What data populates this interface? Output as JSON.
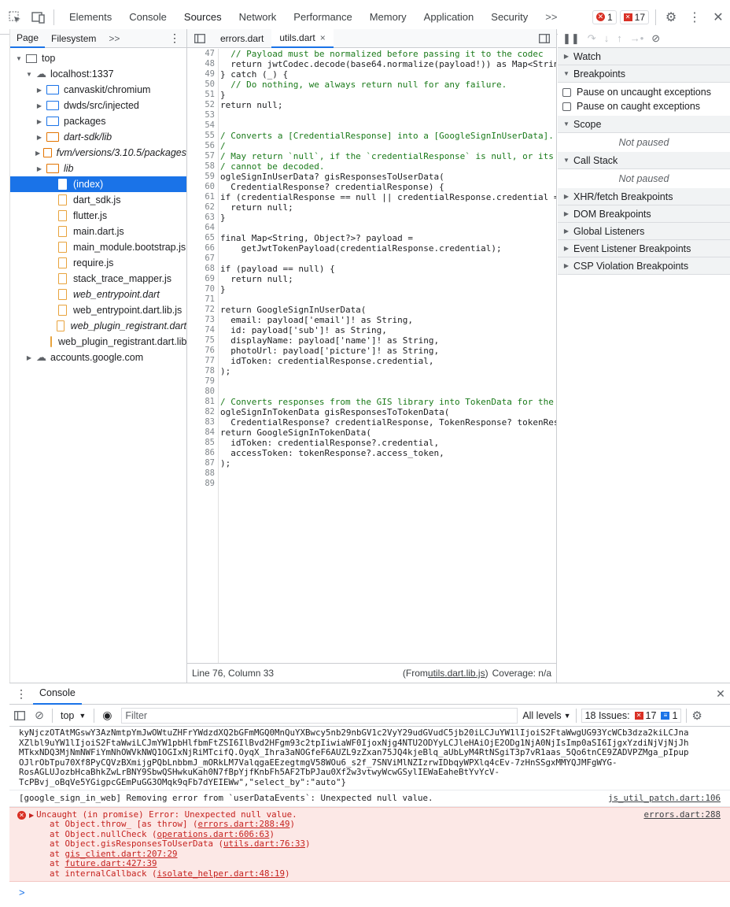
{
  "topbar": {
    "tabs": [
      "Elements",
      "Console",
      "Sources",
      "Network",
      "Performance",
      "Memory",
      "Application",
      "Security"
    ],
    "more": ">>",
    "errors": "1",
    "warnings": "17"
  },
  "nav": {
    "tabs": [
      "Page",
      "Filesystem"
    ],
    "more": ">>",
    "tree": [
      {
        "label": "top",
        "type": "frame",
        "indent": 0,
        "tri": "▼"
      },
      {
        "label": "localhost:1337",
        "type": "cloud",
        "indent": 1,
        "tri": "▼"
      },
      {
        "label": "canvaskit/chromium",
        "type": "folder",
        "indent": 2,
        "tri": "▶"
      },
      {
        "label": "dwds/src/injected",
        "type": "folder",
        "indent": 2,
        "tri": "▶"
      },
      {
        "label": "packages",
        "type": "folder",
        "indent": 2,
        "tri": "▶"
      },
      {
        "label": "dart-sdk/lib",
        "type": "folder-orange",
        "indent": 2,
        "tri": "▶",
        "italic": true
      },
      {
        "label": "fvm/versions/3.10.5/packages",
        "type": "folder-orange",
        "indent": 2,
        "tri": "▶",
        "italic": true
      },
      {
        "label": "lib",
        "type": "folder-orange",
        "indent": 2,
        "tri": "▶",
        "italic": true
      },
      {
        "label": "(index)",
        "type": "file",
        "indent": 3,
        "sel": true
      },
      {
        "label": "dart_sdk.js",
        "type": "file",
        "indent": 3
      },
      {
        "label": "flutter.js",
        "type": "file",
        "indent": 3
      },
      {
        "label": "main.dart.js",
        "type": "file",
        "indent": 3
      },
      {
        "label": "main_module.bootstrap.js",
        "type": "file",
        "indent": 3
      },
      {
        "label": "require.js",
        "type": "file",
        "indent": 3
      },
      {
        "label": "stack_trace_mapper.js",
        "type": "file",
        "indent": 3
      },
      {
        "label": "web_entrypoint.dart",
        "type": "file",
        "indent": 3,
        "italic": true
      },
      {
        "label": "web_entrypoint.dart.lib.js",
        "type": "file",
        "indent": 3
      },
      {
        "label": "web_plugin_registrant.dart",
        "type": "file",
        "indent": 3,
        "italic": true
      },
      {
        "label": "web_plugin_registrant.dart.lib.js",
        "type": "file",
        "indent": 3
      },
      {
        "label": "accounts.google.com",
        "type": "cloud",
        "indent": 1,
        "tri": "▶"
      }
    ]
  },
  "editor": {
    "tabs": [
      "errors.dart",
      "utils.dart"
    ],
    "close": "×",
    "lines": [
      [
        "47",
        "  // Payload must be normalized before passing it to the codec",
        "cm"
      ],
      [
        "48",
        "  return jwtCodec.decode(base64.normalize(payload!)) as Map<String",
        ""
      ],
      [
        "49",
        "} catch (_) {",
        ""
      ],
      [
        "50",
        "  // Do nothing, we always return null for any failure.",
        "cm"
      ],
      [
        "51",
        "}",
        ""
      ],
      [
        "52",
        "return null;",
        ""
      ],
      [
        "53",
        "",
        ""
      ],
      [
        "54",
        "",
        ""
      ],
      [
        "55",
        "/ Converts a [CredentialResponse] into a [GoogleSignInUserData].",
        "cm"
      ],
      [
        "56",
        "/",
        "cm"
      ],
      [
        "57",
        "/ May return `null`, if the `credentialResponse` is null, or its",
        "cm"
      ],
      [
        "58",
        "/ cannot be decoded.",
        "cm"
      ],
      [
        "59",
        "ogleSignInUserData? gisResponsesToUserData(",
        ""
      ],
      [
        "60",
        "  CredentialResponse? credentialResponse) {",
        ""
      ],
      [
        "61",
        "if (credentialResponse == null || credentialResponse.credential ==",
        ""
      ],
      [
        "62",
        "  return null;",
        ""
      ],
      [
        "63",
        "}",
        ""
      ],
      [
        "64",
        "",
        ""
      ],
      [
        "65",
        "final Map<String, Object?>? payload =",
        ""
      ],
      [
        "66",
        "    getJwtTokenPayload(credentialResponse.credential);",
        ""
      ],
      [
        "67",
        "",
        ""
      ],
      [
        "68",
        "if (payload == null) {",
        ""
      ],
      [
        "69",
        "  return null;",
        ""
      ],
      [
        "70",
        "}",
        ""
      ],
      [
        "71",
        "",
        ""
      ],
      [
        "72",
        "return GoogleSignInUserData(",
        ""
      ],
      [
        "73",
        "  email: payload['email']! as String,",
        ""
      ],
      [
        "74",
        "  id: payload['sub']! as String,",
        ""
      ],
      [
        "75",
        "  displayName: payload['name']! as String,",
        ""
      ],
      [
        "76",
        "  photoUrl: payload['picture']! as String,",
        ""
      ],
      [
        "77",
        "  idToken: credentialResponse.credential,",
        ""
      ],
      [
        "78",
        ");",
        ""
      ],
      [
        "79",
        "",
        ""
      ],
      [
        "80",
        "",
        ""
      ],
      [
        "81",
        "/ Converts responses from the GIS library into TokenData for the",
        "cm"
      ],
      [
        "82",
        "ogleSignInTokenData gisResponsesToTokenData(",
        ""
      ],
      [
        "83",
        "  CredentialResponse? credentialResponse, TokenResponse? tokenRes",
        ""
      ],
      [
        "84",
        "return GoogleSignInTokenData(",
        ""
      ],
      [
        "85",
        "  idToken: credentialResponse?.credential,",
        ""
      ],
      [
        "86",
        "  accessToken: tokenResponse?.access_token,",
        ""
      ],
      [
        "87",
        ");",
        ""
      ],
      [
        "88",
        "",
        ""
      ],
      [
        "89",
        "",
        ""
      ]
    ],
    "status_left": "Line 76, Column 33",
    "status_from": "(From ",
    "status_link": "utils.dart.lib.js",
    "status_close": ")",
    "coverage": "Coverage: n/a"
  },
  "debugger": {
    "sections": [
      "Watch",
      "Breakpoints"
    ],
    "checks": [
      "Pause on uncaught exceptions",
      "Pause on caught exceptions"
    ],
    "scope": "Scope",
    "not_paused": "Not paused",
    "callstack": "Call Stack",
    "more": [
      "XHR/fetch Breakpoints",
      "DOM Breakpoints",
      "Global Listeners",
      "Event Listener Breakpoints",
      "CSP Violation Breakpoints"
    ]
  },
  "console": {
    "title": "Console",
    "context": "top",
    "filter_placeholder": "Filter",
    "levels": "All levels",
    "issues_label": "18 Issues:",
    "issues_err": "17",
    "issues_info": "1",
    "jwt": [
      "kyNjczOTAtMGswY3AzNmtpYmJwOWtuZHFrYWdzdXQ2bGFmMGQ0MnQuYXBwcy5nb29nbGV1c2VyY29udGVudC5jb20iLCJuYW1lIjoiS2FtaWwgUG93YcWCb3dza2kiLCJna",
      "XZlbl9uYW1lIjoiS2FtaWwiLCJmYW1pbHlfbmFtZSI6IlBvd2HFgm93c2tpIiwiaWF0IjoxNjg4NTU2ODYyLCJleHAiOjE2ODg1NjA0NjIsImp0aSI6IjgxYzdiNjVjNjJh",
      "MTkxNDQ3MjNmNWFiYmNhOWVkNWQ1OGIxNjRiMTcifQ.OyqX_Ihra3aNOGfeF6AUZL9zZxan75JQ4kjeBlq_aUbLyM4RtNSgiT3p7vR1aas_5Qo6tnCE9ZADVPZMga_pIpup",
      "OJlrObTpu70Xf8PyCQVzBXmijgPQbLnbbmJ_mORkLM7ValqgaEEzegtmgV58WOu6_s2f_7SNViMlNZIzrwIDbqyWPXlq4cEv-7zHnSSgxMMYQJMFgWYG-",
      "RosAGLUJozbHcaBhkZwLrBNY9SbwQSHwkuKah0N7fBpYjfKnbFh5AF2TbPJau0Xf2w3vtwyWcwGSylIEWaEaheBtYvYcV-",
      "TcPBvj_oBqVe5YGigpcGEmPuGG3OMqk9qFb7dYEIEWw\",\"select_by\":\"auto\"}"
    ],
    "warn_msg": "[google_sign_in_web] Removing error from `userDataEvents`: Unexpected null value.",
    "warn_src": "js_util_patch.dart:106",
    "err_msg": "Uncaught (in promise) Error: Unexpected null value.",
    "err_src": "errors.dart:288",
    "stack": [
      [
        "at Object.throw_ [as throw] (",
        "errors.dart:288:49",
        ")"
      ],
      [
        "at Object.nullCheck (",
        "operations.dart:606:63",
        ")"
      ],
      [
        "at Object.gisResponsesToUserData (",
        "utils.dart:76:33",
        ")"
      ],
      [
        "at ",
        "gis_client.dart:207:29",
        ""
      ],
      [
        "at ",
        "future.dart:427:39",
        ""
      ],
      [
        "at internalCallback (",
        "isolate_helper.dart:48:19",
        ")"
      ]
    ],
    "prompt": ">"
  }
}
